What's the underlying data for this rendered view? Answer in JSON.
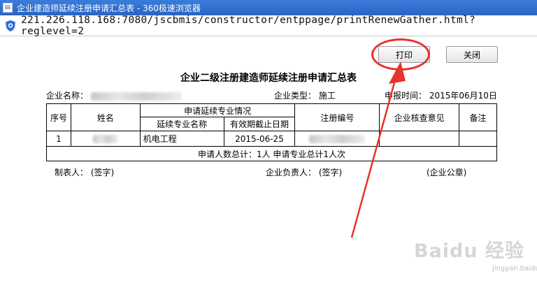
{
  "window": {
    "title": "企业建造师延续注册申请汇总表 - 360极速浏览器",
    "url": "221.226.118.168:7080/jscbmis/constructor/entppage/printRenewGather.html?reglevel=2"
  },
  "toolbar": {
    "print_label": "打印",
    "close_label": "关闭"
  },
  "doc": {
    "title": "企业二级注册建造师延续注册申请汇总表",
    "company_name_label": "企业名称：",
    "company_type_label": "企业类型：",
    "company_type_value": "施工",
    "report_date_label": "申报时间：",
    "report_date_value": "2015年06月10日"
  },
  "table": {
    "headers": {
      "seq": "序号",
      "name": "姓名",
      "renew_info": "申请延续专业情况",
      "major": "延续专业名称",
      "expiry": "有效期截止日期",
      "reg_no": "注册编号",
      "opinion": "企业核查意见",
      "remark": "备注"
    },
    "rows": [
      {
        "seq": "1",
        "major": "机电工程",
        "expiry": "2015-06-25",
        "opinion": "",
        "remark": ""
      }
    ],
    "summary": "申请人数总计：1人  申请专业总计1人次"
  },
  "footer": {
    "maker": "制表人：  (签字)",
    "leader": "企业负责人：  (签字)",
    "seal": "(企业公章)"
  },
  "watermark": {
    "logo": "Baidu 经验",
    "sub": "jingyan.baidu.com"
  },
  "colors": {
    "annotation": "#e8322c",
    "titlebar": "#2a64c4"
  }
}
